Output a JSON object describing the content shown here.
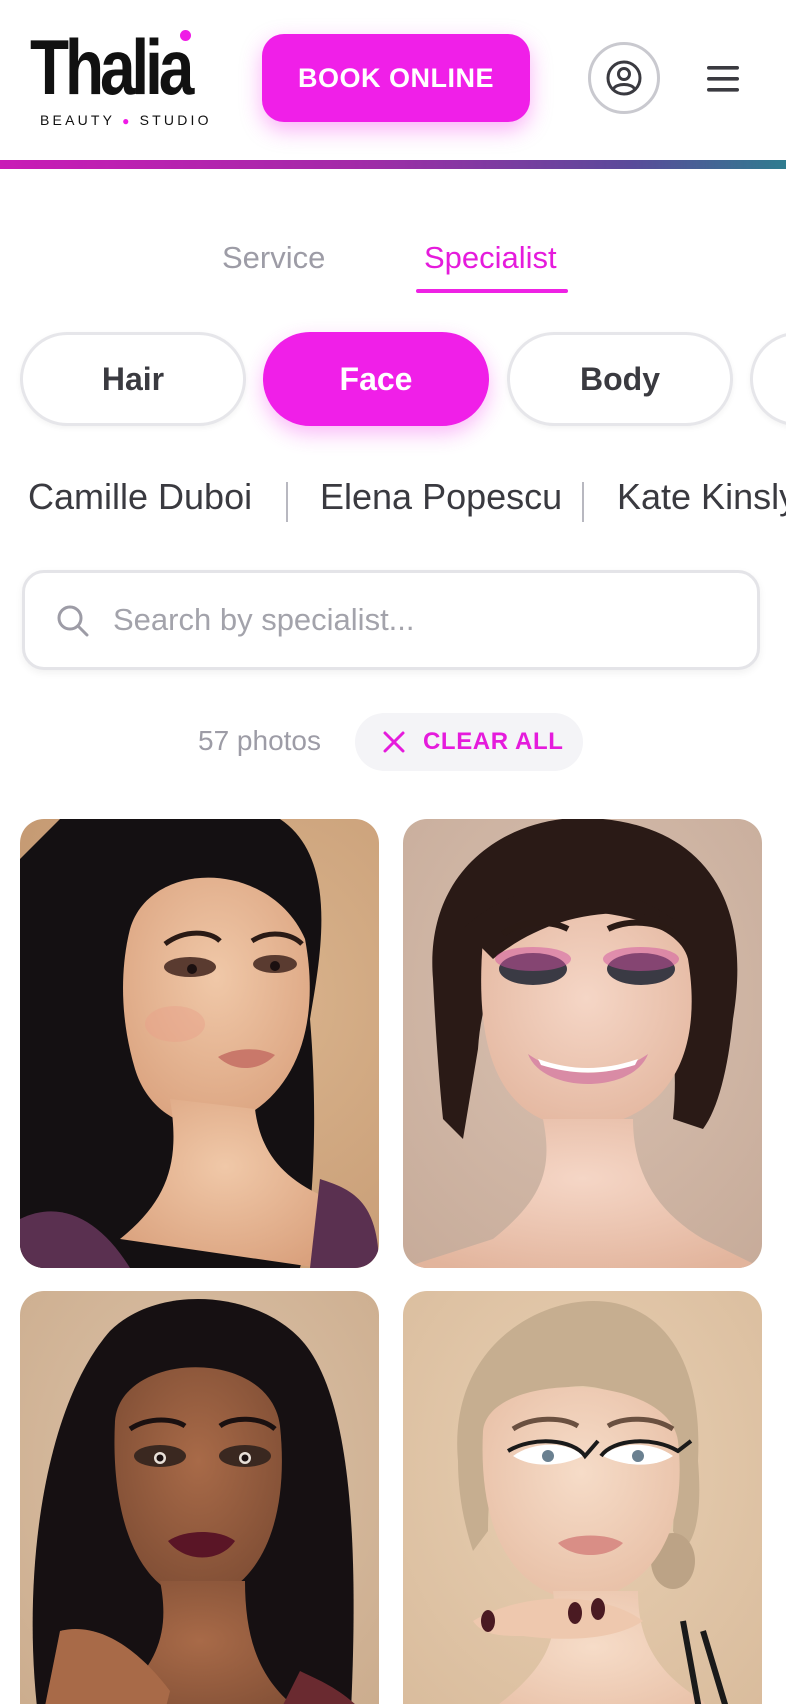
{
  "brand": {
    "name": "Thalia",
    "tagline_left": "BEAUTY",
    "tagline_right": "STUDIO",
    "accent_color": "#f01fe8"
  },
  "header": {
    "book_label": "BOOK ONLINE",
    "account_icon": "user-circle-icon",
    "menu_icon": "hamburger-menu-icon"
  },
  "tabs": [
    {
      "label": "Service",
      "active": false
    },
    {
      "label": "Specialist",
      "active": true
    }
  ],
  "categories": [
    {
      "label": "Hair",
      "active": false
    },
    {
      "label": "Face",
      "active": true
    },
    {
      "label": "Body",
      "active": false
    },
    {
      "label": "",
      "active": false
    }
  ],
  "specialists": [
    "Camille Duboi",
    "Elena Popescu",
    "Kate Kinsly"
  ],
  "search": {
    "placeholder": "Search by specialist...",
    "value": ""
  },
  "results": {
    "count_label": "57 photos",
    "clear_label": "CLEAR ALL"
  },
  "photos": [
    {
      "alt": "Woman with long black hair and smoky bronze eye makeup"
    },
    {
      "alt": "Woman with dark bob, sparkly smoky eyes and pink lips, smiling"
    },
    {
      "alt": "Woman with dark skin, smoky eyes and burgundy lips"
    },
    {
      "alt": "Blonde woman with graphic winged eyeliner and dark nails"
    }
  ]
}
